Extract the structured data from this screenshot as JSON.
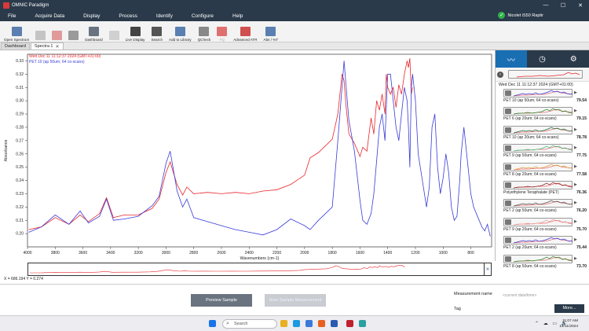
{
  "window": {
    "title": "OMNIC Paradigm",
    "minimize": "—",
    "maximize": "☐",
    "close": "✕"
  },
  "menu": [
    "File",
    "Acquire Data",
    "Display",
    "Process",
    "Identify",
    "Configure",
    "Help"
  ],
  "instrument_status": {
    "label": "Nicolet iS50 Raptir",
    "icon": "check-circle-icon",
    "color": "#2fb34a"
  },
  "toolbar": [
    {
      "label": "Open Spectrum",
      "icon": "open-spectrum-icon",
      "enabled": true,
      "color": "#5a7fb0"
    },
    {
      "label": "",
      "icon": "save-icon",
      "enabled": false,
      "color": "#c4c4c4"
    },
    {
      "label": "",
      "icon": "compare-icon",
      "enabled": false,
      "color": "#e09a9a"
    },
    {
      "label": "",
      "icon": "gear-icon",
      "enabled": false,
      "color": "#9a9a9a"
    },
    {
      "label": "Dashboard",
      "icon": "dashboard-icon",
      "enabled": true,
      "color": "#6a7480"
    },
    {
      "label": "",
      "icon": "blank-icon",
      "enabled": false,
      "color": "#d0d0d0"
    },
    {
      "label": "Live Display",
      "icon": "camera-icon",
      "enabled": true,
      "color": "#444"
    },
    {
      "label": "Search",
      "icon": "search-icon",
      "enabled": true,
      "color": "#555"
    },
    {
      "label": "Add to Library",
      "icon": "library-icon",
      "enabled": true,
      "color": "#5a7fb0"
    },
    {
      "label": "QCheck",
      "icon": "qcheck-icon",
      "enabled": true,
      "color": "#888"
    },
    {
      "label": "TQ",
      "icon": "tq-icon",
      "enabled": false,
      "color": "#e07070"
    },
    {
      "label": "Advanced ATR",
      "icon": "advanced-atr-icon",
      "enabled": true,
      "color": "#d05050"
    },
    {
      "label": "Abs / %T",
      "icon": "abs-t-icon",
      "enabled": true,
      "color": "#5a7fb0"
    }
  ],
  "tabs": [
    {
      "label": "Dashboard",
      "active": false
    },
    {
      "label": "Spectra 1",
      "active": true
    }
  ],
  "chart_data": {
    "type": "line",
    "xlabel": "Wavenumbers (cm-1)",
    "ylabel": "Absorbance",
    "xlim": [
      4000,
      650
    ],
    "ylim": [
      0.19,
      0.335
    ],
    "xticks": [
      4000,
      3800,
      3600,
      3400,
      3200,
      3000,
      2800,
      2600,
      2400,
      2200,
      2000,
      1800,
      1600,
      1400,
      1200,
      1000,
      800
    ],
    "yticks": [
      0.2,
      0.21,
      0.22,
      0.23,
      0.24,
      0.25,
      0.26,
      0.27,
      0.28,
      0.29,
      0.3,
      0.31,
      0.32,
      0.33
    ],
    "ytick_labels": [
      "0.20",
      "0.21",
      "0.22",
      "0.23",
      "0.24",
      "0.25",
      "0.26",
      "0.27",
      "0.28",
      "0.29",
      "0.30",
      "0.31",
      "0.32",
      "0.33"
    ],
    "legend": [
      {
        "text": "Wed Dec 11 11:12:37 2024 (GMT+01:00)",
        "color": "#e8262b"
      },
      {
        "text": "PET 10 (ap 50um; 64 co-scans)",
        "color": "#3a3ad8"
      }
    ],
    "series": [
      {
        "name": "Wed Dec 11 11:12:37 2024 (GMT+01:00)",
        "color": "#e8262b",
        "x": [
          3990,
          3900,
          3800,
          3700,
          3620,
          3560,
          3480,
          3430,
          3380,
          3300,
          3200,
          3100,
          3050,
          3000,
          2970,
          2950,
          2920,
          2880,
          2850,
          2800,
          2700,
          2600,
          2500,
          2400,
          2300,
          2200,
          2100,
          2000,
          1960,
          1900,
          1850,
          1800,
          1760,
          1730,
          1715,
          1700,
          1680,
          1640,
          1600,
          1580,
          1550,
          1520,
          1500,
          1480,
          1460,
          1440,
          1420,
          1410,
          1400,
          1380,
          1360,
          1340,
          1320,
          1300,
          1280,
          1260,
          1250,
          1240,
          1230,
          1220
        ],
        "y": [
          0.203,
          0.205,
          0.212,
          0.207,
          0.214,
          0.209,
          0.215,
          0.227,
          0.212,
          0.214,
          0.214,
          0.219,
          0.226,
          0.246,
          0.254,
          0.247,
          0.237,
          0.229,
          0.235,
          0.23,
          0.231,
          0.23,
          0.231,
          0.23,
          0.232,
          0.233,
          0.237,
          0.244,
          0.257,
          0.261,
          0.266,
          0.271,
          0.29,
          0.32,
          0.315,
          0.295,
          0.275,
          0.268,
          0.258,
          0.265,
          0.262,
          0.287,
          0.275,
          0.3,
          0.293,
          0.305,
          0.29,
          0.32,
          0.31,
          0.305,
          0.31,
          0.295,
          0.312,
          0.305,
          0.32,
          0.33,
          0.325,
          0.332,
          0.305,
          0.31
        ]
      },
      {
        "name": "PET 10 (ap 50um; 64 co-scans)",
        "color": "#3a3ad8",
        "x": [
          3990,
          3900,
          3800,
          3700,
          3620,
          3560,
          3480,
          3430,
          3380,
          3300,
          3200,
          3100,
          3050,
          3000,
          2970,
          2950,
          2920,
          2880,
          2850,
          2800,
          2700,
          2600,
          2500,
          2400,
          2300,
          2200,
          2100,
          2000,
          1960,
          1900,
          1850,
          1800,
          1760,
          1730,
          1715,
          1700,
          1680,
          1640,
          1600,
          1580,
          1550,
          1520,
          1500,
          1480,
          1460,
          1440,
          1420,
          1410,
          1400,
          1380,
          1360,
          1340,
          1320,
          1300,
          1280,
          1260,
          1250,
          1240,
          1230,
          1220,
          1200,
          1180,
          1150,
          1120,
          1100,
          1080,
          1060,
          1040,
          1020,
          1000,
          980,
          960,
          940,
          920,
          900,
          880,
          870,
          850,
          840,
          820,
          800,
          780,
          760,
          740,
          720,
          700,
          680,
          660
        ],
        "y": [
          0.201,
          0.205,
          0.214,
          0.207,
          0.217,
          0.208,
          0.213,
          0.226,
          0.21,
          0.211,
          0.213,
          0.221,
          0.228,
          0.253,
          0.262,
          0.25,
          0.232,
          0.22,
          0.226,
          0.212,
          0.209,
          0.206,
          0.203,
          0.201,
          0.199,
          0.203,
          0.211,
          0.206,
          0.203,
          0.21,
          0.215,
          0.22,
          0.27,
          0.31,
          0.33,
          0.31,
          0.285,
          0.262,
          0.225,
          0.21,
          0.207,
          0.215,
          0.23,
          0.255,
          0.28,
          0.29,
          0.27,
          0.295,
          0.32,
          0.32,
          0.3,
          0.28,
          0.27,
          0.29,
          0.31,
          0.3,
          0.28,
          0.25,
          0.31,
          0.32,
          0.3,
          0.26,
          0.24,
          0.22,
          0.235,
          0.28,
          0.29,
          0.25,
          0.23,
          0.242,
          0.26,
          0.246,
          0.22,
          0.21,
          0.213,
          0.24,
          0.26,
          0.28,
          0.27,
          0.25,
          0.23,
          0.22,
          0.215,
          0.21,
          0.205,
          0.202,
          0.207,
          0.198
        ]
      }
    ]
  },
  "coords": "X = 686.194 Y = 0.274",
  "right_panel": {
    "tabs": [
      {
        "icon": "spectrum-view-icon",
        "glyph": "〰",
        "active": true
      },
      {
        "icon": "clock-icon",
        "glyph": "◷",
        "active": false
      },
      {
        "icon": "settings-gear-icon",
        "glyph": "⚙",
        "active": false
      }
    ],
    "collapse": "‹",
    "reference": "Wed Dec 11 11:12:37 2024 (GMT+01:00)",
    "matches": [
      {
        "name": "PET 10 (ap 50um; 64 co-scans)",
        "score": "79.54",
        "color": "#3a3ad8"
      },
      {
        "name": "PET 6 (ap 20um; 64 co-scans)",
        "score": "79.15",
        "color": "#2e8b2e"
      },
      {
        "name": "PET 10 (ap 20um; 64 co-scans)",
        "score": "78.78",
        "color": "#1f6a3a"
      },
      {
        "name": "PET 9 (ap 50um; 64 co-scans)",
        "score": "77.75",
        "color": "#3fbf7f"
      },
      {
        "name": "PET 8 (ap 20um; 64 co-scans)",
        "score": "77.58",
        "color": "#e0a040"
      },
      {
        "name": "Polyethylene Teraphalate (PET)",
        "score": "76.36",
        "color": "#8a2a2a"
      },
      {
        "name": "PET 2 (ap 50um; 64 co-scans)",
        "score": "76.20",
        "color": "#555555"
      },
      {
        "name": "PET 9 (ap 20um; 64 co-scans)",
        "score": "75.70",
        "color": "#e8a0a0"
      },
      {
        "name": "PET 2 (ap 20um; 64 co-scans)",
        "score": "75.44",
        "color": "#3a3ad8"
      },
      {
        "name": "PET 8 (ap 50um; 64 co-scans)",
        "score": "73.70",
        "color": "#2e8b2e"
      }
    ]
  },
  "bottom": {
    "preview_button": "Preview Sample",
    "start_button": "Start Sample Measurement",
    "measurement_label": "Measurement name",
    "measurement_placeholder": "<current date/time>",
    "tag_label": "Tag",
    "more_button": "More..."
  },
  "taskbar": {
    "search": "Search",
    "time": "11:07 AM",
    "date": "12/11/2024",
    "tray": "⌃ ☁ ▭ 🔊",
    "apps": [
      {
        "icon": "windows-start-icon",
        "color": "#1a73e8"
      },
      {
        "icon": "file-explorer-icon",
        "color": "#e8b020"
      },
      {
        "icon": "edge-browser-icon",
        "color": "#1a9ae0"
      },
      {
        "icon": "ms-store-icon",
        "color": "#3a7ad8"
      },
      {
        "icon": "app-orange-icon",
        "color": "#e86020"
      },
      {
        "icon": "app-mail-icon",
        "color": "#2a5ab0"
      },
      {
        "icon": "omnic-paradigm-icon",
        "color": "#c02030"
      },
      {
        "icon": "app-globe-icon",
        "color": "#2aa0a0"
      }
    ]
  }
}
